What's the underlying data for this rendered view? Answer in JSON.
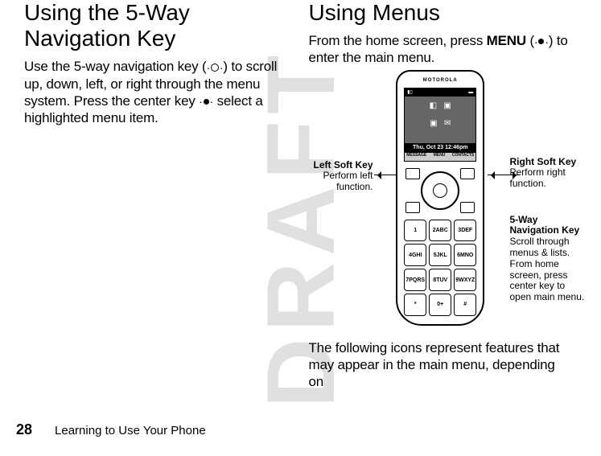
{
  "watermark": "DRAFT",
  "left": {
    "heading": "Using the 5-Way Navigation Key",
    "body_pre": "Use the 5-way navigation key (",
    "body_mid": ") to scroll up, down, left, or right through the menu system. Press the center key ",
    "body_post": " select a highlighted menu item."
  },
  "right": {
    "heading": "Using Menus",
    "body_pre": "From the home screen, press ",
    "menu_word": "MENU",
    "body_mid": " (",
    "body_post": ") to enter the main menu.",
    "trailer": "The following icons represent features that may appear in the main menu, depending on"
  },
  "phone": {
    "brand": "MOTOROLA",
    "date": "Thu, Oct 23 12:46pm",
    "soft_left": "MESSAGE",
    "soft_center": "MENU",
    "soft_right": "CONTACTS",
    "keys": [
      "1",
      "2ABC",
      "3DEF",
      "4GHI",
      "5JKL",
      "6MNO",
      "7PQRS",
      "8TUV",
      "9WXYZ",
      "*",
      "0+",
      "#"
    ]
  },
  "labels": {
    "left_soft_title": "Left Soft Key",
    "left_soft_body": "Perform left function.",
    "right_soft_title": "Right Soft Key",
    "right_soft_body": "Perform right function.",
    "nav_title": "5-Way Navigation Key",
    "nav_body": "Scroll through menus & lists. From home screen, press center key to open main menu."
  },
  "footer": {
    "page": "28",
    "title": "Learning to Use Your Phone"
  }
}
